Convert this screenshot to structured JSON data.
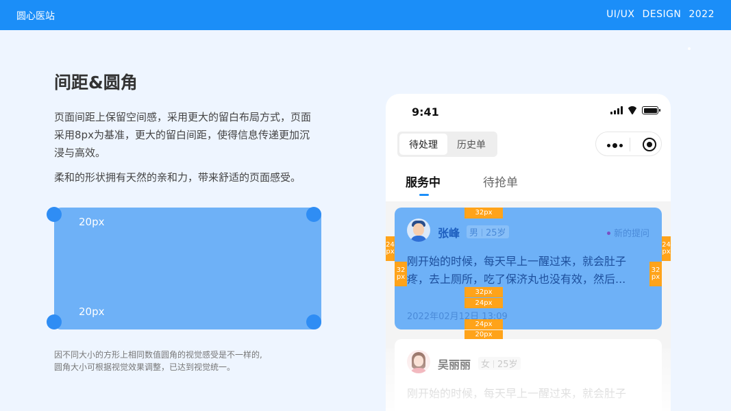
{
  "header": {
    "brand": "圆心医站",
    "tag": "UI/UX DESIGN 2022",
    "bg_color": "#1b8ef8"
  },
  "left": {
    "title": "间距&圆角",
    "desc1": "页面间距上保留空间感，采用更大的留白布局方式，页面采用8px为基准，更大的留白间距，使得信息传递更加沉浸与高效。",
    "desc2": "柔和的形状拥有天然的亲和力，带来舒适的页面感受。",
    "demo_label_top": "20px",
    "demo_label_bottom": "20px",
    "note_line1": "因不同大小的方形上相同数值圆角的视觉感受是不一样的,",
    "note_line2": "圆角大小可根据视觉效果调整，已达到视觉统一。",
    "box_color": "#6eb1f7",
    "corner_color": "#2f8df4"
  },
  "phone": {
    "time": "9:41",
    "segment": [
      "待处理",
      "历史单"
    ],
    "tabs": [
      "服务中",
      "待抢单"
    ],
    "accent": "#1b8ef8",
    "cards": [
      {
        "name": "张峰",
        "gender": "男",
        "age": "25岁",
        "tag": "新的提问",
        "content": "刚开始的时候，每天早上一醒过来，就会肚子疼，去上厕所，吃了保济丸也没有效，然后...",
        "date": "2022年02月12日 13:09"
      },
      {
        "name": "吴丽丽",
        "gender": "女",
        "age": "25岁",
        "content": "刚开始的时候，每天早上一醒过来，就会肚子"
      }
    ]
  },
  "measures": {
    "top_gap": "32px",
    "left_outer_value": "24",
    "left_outer_unit": "px",
    "left_inner_value": "32",
    "left_inner_unit": "px",
    "right_outer_value": "24",
    "right_outer_unit": "px",
    "right_inner_value": "32",
    "right_inner_unit": "px",
    "text_bottom_gap": "32px",
    "date_top_gap": "24px",
    "bottom_gap": "24px",
    "card_gap": "20px",
    "color": "#ffa31a"
  }
}
